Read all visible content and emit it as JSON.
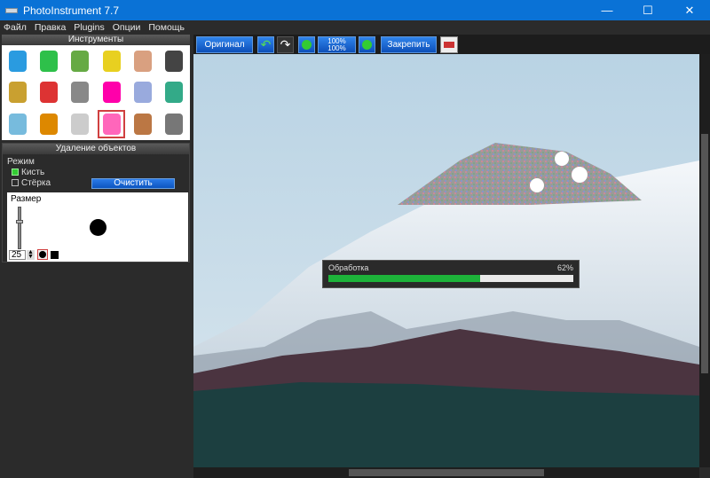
{
  "window": {
    "title": "PhotoInstrument 7.7",
    "minimize": "—",
    "maximize": "☐",
    "close": "✕"
  },
  "menu": [
    "Файл",
    "Правка",
    "Plugins",
    "Опции",
    "Помощь"
  ],
  "tools_panel": {
    "title": "Инструменты",
    "icons": [
      "drop-icon",
      "cone-icon",
      "pencil-icon",
      "stamp-icon",
      "brush-icon",
      "joystick-icon",
      "shield-icon",
      "color-wheel-icon",
      "gradient-icon",
      "spectrum-icon",
      "lines-icon",
      "scissors-icon",
      "glass-icon",
      "bottle-icon",
      "bulb-icon",
      "eraser-icon",
      "box-icon",
      "text-layers-icon"
    ],
    "selected": 15
  },
  "object_removal": {
    "title": "Удаление объектов",
    "mode_label": "Режим",
    "brush_label": "Кисть",
    "eraser_label": "Стёрка",
    "brush_checked": true,
    "clear_button": "Очистить",
    "size_label": "Размер",
    "size_value": "25"
  },
  "toolbar": {
    "original": "Оригинал",
    "zoom_top": "100%",
    "zoom_bottom": "100%",
    "pin": "Закрепить"
  },
  "progress": {
    "label": "Обработка",
    "percent_text": "62%",
    "value": 0.62,
    "color": "#1db33a"
  }
}
